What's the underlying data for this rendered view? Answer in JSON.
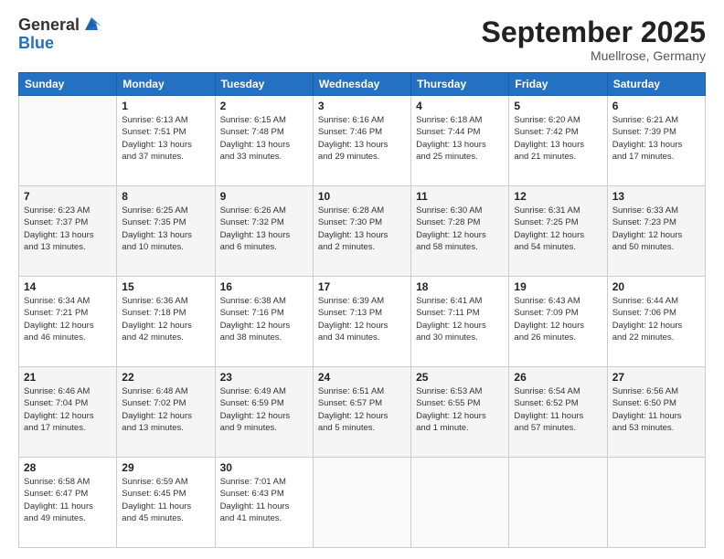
{
  "header": {
    "logo_general": "General",
    "logo_blue": "Blue",
    "month": "September 2025",
    "location": "Muellrose, Germany"
  },
  "days_of_week": [
    "Sunday",
    "Monday",
    "Tuesday",
    "Wednesday",
    "Thursday",
    "Friday",
    "Saturday"
  ],
  "weeks": [
    [
      {
        "day": "",
        "info": ""
      },
      {
        "day": "1",
        "info": "Sunrise: 6:13 AM\nSunset: 7:51 PM\nDaylight: 13 hours\nand 37 minutes."
      },
      {
        "day": "2",
        "info": "Sunrise: 6:15 AM\nSunset: 7:48 PM\nDaylight: 13 hours\nand 33 minutes."
      },
      {
        "day": "3",
        "info": "Sunrise: 6:16 AM\nSunset: 7:46 PM\nDaylight: 13 hours\nand 29 minutes."
      },
      {
        "day": "4",
        "info": "Sunrise: 6:18 AM\nSunset: 7:44 PM\nDaylight: 13 hours\nand 25 minutes."
      },
      {
        "day": "5",
        "info": "Sunrise: 6:20 AM\nSunset: 7:42 PM\nDaylight: 13 hours\nand 21 minutes."
      },
      {
        "day": "6",
        "info": "Sunrise: 6:21 AM\nSunset: 7:39 PM\nDaylight: 13 hours\nand 17 minutes."
      }
    ],
    [
      {
        "day": "7",
        "info": "Sunrise: 6:23 AM\nSunset: 7:37 PM\nDaylight: 13 hours\nand 13 minutes."
      },
      {
        "day": "8",
        "info": "Sunrise: 6:25 AM\nSunset: 7:35 PM\nDaylight: 13 hours\nand 10 minutes."
      },
      {
        "day": "9",
        "info": "Sunrise: 6:26 AM\nSunset: 7:32 PM\nDaylight: 13 hours\nand 6 minutes."
      },
      {
        "day": "10",
        "info": "Sunrise: 6:28 AM\nSunset: 7:30 PM\nDaylight: 13 hours\nand 2 minutes."
      },
      {
        "day": "11",
        "info": "Sunrise: 6:30 AM\nSunset: 7:28 PM\nDaylight: 12 hours\nand 58 minutes."
      },
      {
        "day": "12",
        "info": "Sunrise: 6:31 AM\nSunset: 7:25 PM\nDaylight: 12 hours\nand 54 minutes."
      },
      {
        "day": "13",
        "info": "Sunrise: 6:33 AM\nSunset: 7:23 PM\nDaylight: 12 hours\nand 50 minutes."
      }
    ],
    [
      {
        "day": "14",
        "info": "Sunrise: 6:34 AM\nSunset: 7:21 PM\nDaylight: 12 hours\nand 46 minutes."
      },
      {
        "day": "15",
        "info": "Sunrise: 6:36 AM\nSunset: 7:18 PM\nDaylight: 12 hours\nand 42 minutes."
      },
      {
        "day": "16",
        "info": "Sunrise: 6:38 AM\nSunset: 7:16 PM\nDaylight: 12 hours\nand 38 minutes."
      },
      {
        "day": "17",
        "info": "Sunrise: 6:39 AM\nSunset: 7:13 PM\nDaylight: 12 hours\nand 34 minutes."
      },
      {
        "day": "18",
        "info": "Sunrise: 6:41 AM\nSunset: 7:11 PM\nDaylight: 12 hours\nand 30 minutes."
      },
      {
        "day": "19",
        "info": "Sunrise: 6:43 AM\nSunset: 7:09 PM\nDaylight: 12 hours\nand 26 minutes."
      },
      {
        "day": "20",
        "info": "Sunrise: 6:44 AM\nSunset: 7:06 PM\nDaylight: 12 hours\nand 22 minutes."
      }
    ],
    [
      {
        "day": "21",
        "info": "Sunrise: 6:46 AM\nSunset: 7:04 PM\nDaylight: 12 hours\nand 17 minutes."
      },
      {
        "day": "22",
        "info": "Sunrise: 6:48 AM\nSunset: 7:02 PM\nDaylight: 12 hours\nand 13 minutes."
      },
      {
        "day": "23",
        "info": "Sunrise: 6:49 AM\nSunset: 6:59 PM\nDaylight: 12 hours\nand 9 minutes."
      },
      {
        "day": "24",
        "info": "Sunrise: 6:51 AM\nSunset: 6:57 PM\nDaylight: 12 hours\nand 5 minutes."
      },
      {
        "day": "25",
        "info": "Sunrise: 6:53 AM\nSunset: 6:55 PM\nDaylight: 12 hours\nand 1 minute."
      },
      {
        "day": "26",
        "info": "Sunrise: 6:54 AM\nSunset: 6:52 PM\nDaylight: 11 hours\nand 57 minutes."
      },
      {
        "day": "27",
        "info": "Sunrise: 6:56 AM\nSunset: 6:50 PM\nDaylight: 11 hours\nand 53 minutes."
      }
    ],
    [
      {
        "day": "28",
        "info": "Sunrise: 6:58 AM\nSunset: 6:47 PM\nDaylight: 11 hours\nand 49 minutes."
      },
      {
        "day": "29",
        "info": "Sunrise: 6:59 AM\nSunset: 6:45 PM\nDaylight: 11 hours\nand 45 minutes."
      },
      {
        "day": "30",
        "info": "Sunrise: 7:01 AM\nSunset: 6:43 PM\nDaylight: 11 hours\nand 41 minutes."
      },
      {
        "day": "",
        "info": ""
      },
      {
        "day": "",
        "info": ""
      },
      {
        "day": "",
        "info": ""
      },
      {
        "day": "",
        "info": ""
      }
    ]
  ]
}
